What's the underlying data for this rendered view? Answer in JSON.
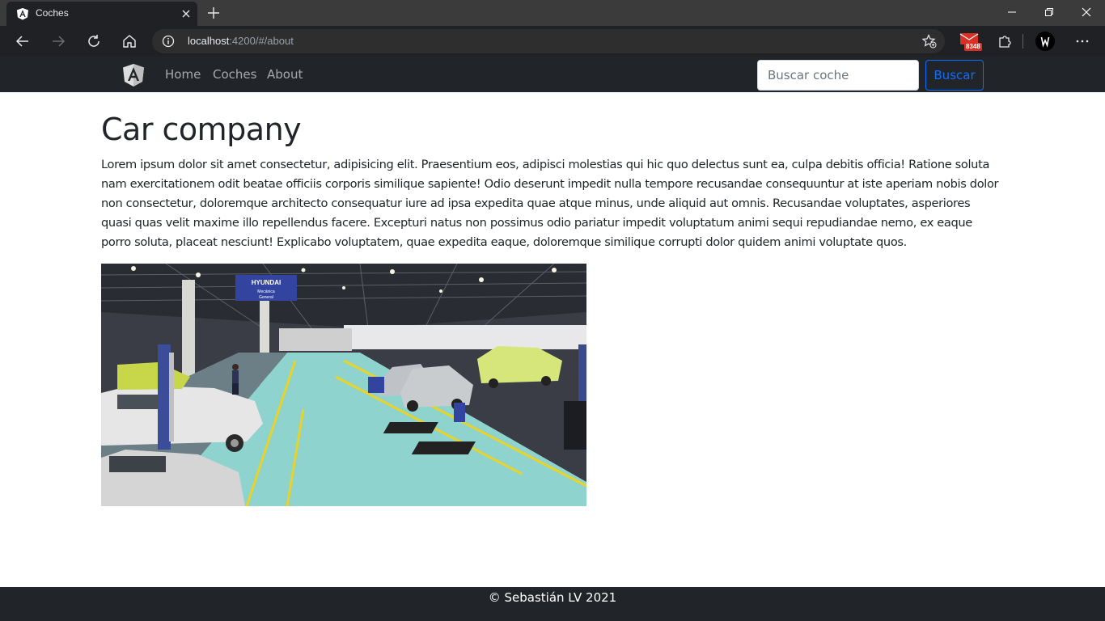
{
  "browser": {
    "tab": {
      "title": "Coches",
      "favicon": "angular-icon"
    },
    "address": {
      "host": "localhost",
      "rest": ":4200/#/about"
    },
    "extensions": {
      "mail_badge": "8348"
    }
  },
  "navbar": {
    "brand_icon": "angular-logo",
    "links": [
      {
        "label": "Home"
      },
      {
        "label": "Coches"
      },
      {
        "label": "About"
      }
    ],
    "search": {
      "placeholder": "Buscar coche",
      "button_label": "Buscar"
    }
  },
  "main": {
    "title": "Car company",
    "paragraph": "Lorem ipsum dolor sit amet consectetur, adipisicing elit. Praesentium eos, adipisci molestias qui hic quo delectus sunt ea, culpa debitis officia! Ratione soluta nam exercitationem odit beatae officiis corporis similique sapiente! Odio deserunt impedit nulla tempore recusandae consequuntur at iste aperiam nobis dolor non consectetur, doloremque architecto consequatur iure ad ipsa expedita quae atque minus, unde aliquid aut omnis. Recusandae voluptates, asperiores quasi quas velit maxime illo repellendus facere. Excepturi natus non possimus odio pariatur impedit voluptatum animi sequi repudiandae nemo, ex eaque porro soluta, placeat nesciunt! Explicabo voluptatem, quae expedita eaque, doloremque similique corrupti dolor quidem animi voluptate quos.",
    "image": {
      "sign_brand": "HYUNDAI",
      "sign_line1": "Mecánica",
      "sign_line2": "General"
    }
  },
  "footer": {
    "text": "© Sebastián LV 2021"
  },
  "colors": {
    "navbar_bg": "#212529",
    "primary": "#0d6efd",
    "floor": "#8fd3cf"
  }
}
